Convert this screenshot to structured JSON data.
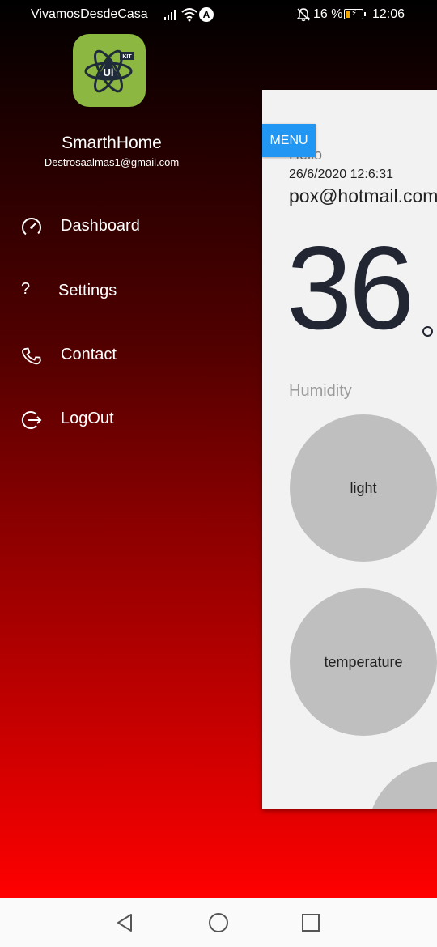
{
  "status_bar": {
    "carrier": "VivamosDesdeCasa",
    "nav_indicator": "A",
    "battery_percent": "16 %",
    "time": "12:06"
  },
  "app": {
    "logo_text": "Ui",
    "logo_badge": "KIT",
    "title": "SmarthHome",
    "email": "Destrosaalmas1@gmail.com"
  },
  "menu": {
    "items": [
      {
        "label": "Dashboard",
        "icon": "speedometer-icon"
      },
      {
        "label": "Settings",
        "icon": "question-mark-icon"
      },
      {
        "label": "Contact",
        "icon": "phone-icon"
      },
      {
        "label": "LogOut",
        "icon": "logout-icon"
      }
    ]
  },
  "panel": {
    "hello": "Hello",
    "menu_button": "MENU",
    "datetime": "26/6/2020 12:6:31",
    "email": "pox@hotmail.com",
    "big_value": "36",
    "humidity_label": "Humidity",
    "circles": [
      {
        "label": "light"
      },
      {
        "label": "temperature"
      }
    ]
  },
  "colors": {
    "gradient_top": "#000000",
    "gradient_bottom": "#ff0000",
    "menu_button": "#2196f3",
    "logo_bg": "#8cb740",
    "circle": "#bfbfbf"
  }
}
